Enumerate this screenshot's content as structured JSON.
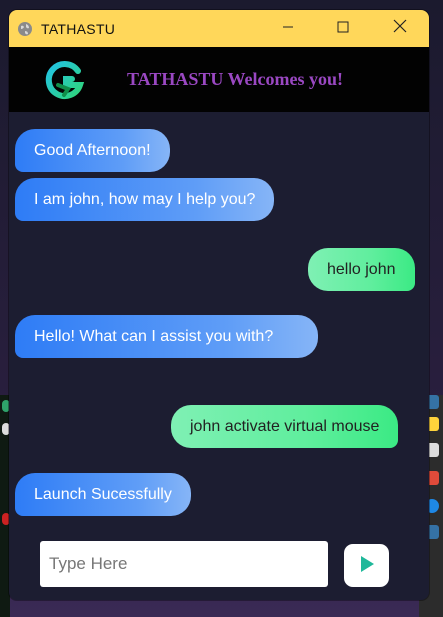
{
  "window": {
    "title": "TATHASTU",
    "controls": {
      "minimize_icon": "minimize-icon",
      "maximize_icon": "maximize-icon",
      "close_icon": "close-icon"
    }
  },
  "header": {
    "welcome_text": "TATHASTU Welcomes you!",
    "logo": "g-logo"
  },
  "messages": [
    {
      "sender": "bot",
      "text": "Good Afternoon!"
    },
    {
      "sender": "bot",
      "text": "I am john, how may I help you?"
    },
    {
      "sender": "user",
      "text": "hello john"
    },
    {
      "sender": "bot",
      "text": "Hello! What can I assist you with?"
    },
    {
      "sender": "user",
      "text": "john activate virtual mouse"
    },
    {
      "sender": "bot",
      "text": "Launch Sucessfully"
    }
  ],
  "composer": {
    "placeholder": "Type Here",
    "value": "",
    "send_icon": "play-send-icon"
  },
  "colors": {
    "titlebar": "#ffd75a",
    "header_bg": "#020202",
    "welcome_text": "#9a48c2",
    "chat_bg": "#1c1d31",
    "bot_bubble": "#2e7cf6",
    "user_bubble": "#5fee9d",
    "send_arrow": "#1fb89a"
  }
}
